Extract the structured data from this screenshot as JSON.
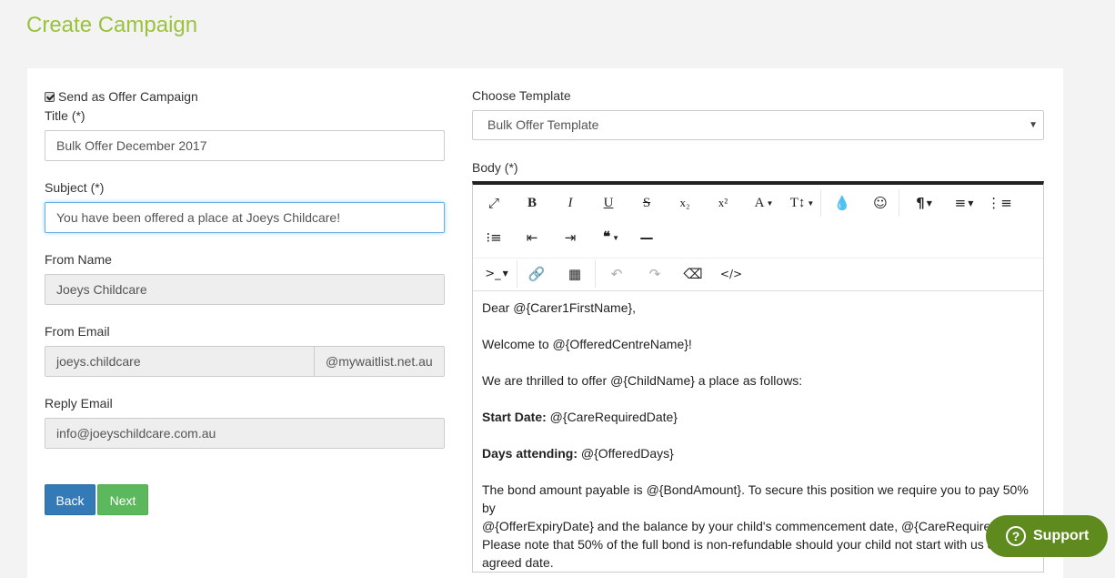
{
  "page": {
    "title": "Create Campaign"
  },
  "form": {
    "offer_checkbox_label": "Send as Offer Campaign",
    "offer_checked": true,
    "title_label": "Title (*)",
    "title_value": "Bulk Offer December 2017",
    "subject_label": "Subject (*)",
    "subject_value": "You have been offered a place at Joeys Childcare!",
    "from_name_label": "From Name",
    "from_name_value": "Joeys Childcare",
    "from_email_label": "From Email",
    "from_email_value": "joeys.childcare",
    "from_email_domain": "@mywaitlist.net.au",
    "reply_email_label": "Reply Email",
    "reply_email_value": "info@joeyschildcare.com.au",
    "back_label": "Back",
    "next_label": "Next"
  },
  "template": {
    "label": "Choose Template",
    "selected": "Bulk Offer Template"
  },
  "body": {
    "label": "Body (*)",
    "toolbar": {
      "bold": "B",
      "italic": "I",
      "underline": "U",
      "strikethrough": "S",
      "subscript": "x₂",
      "superscript": "x²",
      "font_color": "A",
      "font_size": "T↕",
      "emoji": "☺",
      "paragraph": "¶",
      "quote": "❝"
    },
    "lines": {
      "greeting": "Dear @{Carer1FirstName},",
      "welcome": "Welcome to @{OfferedCentreName}!",
      "offer": "We are thrilled to offer @{ChildName} a place as follows:",
      "start_date_label": "Start Date:",
      "start_date_value": " @{CareRequiredDate}",
      "days_label": "Days attending:",
      "days_value": " @{OfferedDays}",
      "bond_1": "The bond amount payable is @{BondAmount}.  To secure this position we require you to pay 50% by",
      "bond_2": "@{OfferExpiryDate} and the balance by your child's commencement date, @{CareRequiredDate}.",
      "bond_3": "Please note that 50% of the full bond is non-refundable should your child not start with us on",
      "bond_4": "agreed date."
    }
  },
  "support": {
    "label": "Support"
  },
  "colors": {
    "title": "#9ac33b",
    "back": "#337ab7",
    "next": "#5cb85c",
    "support": "#5f8a1e"
  }
}
